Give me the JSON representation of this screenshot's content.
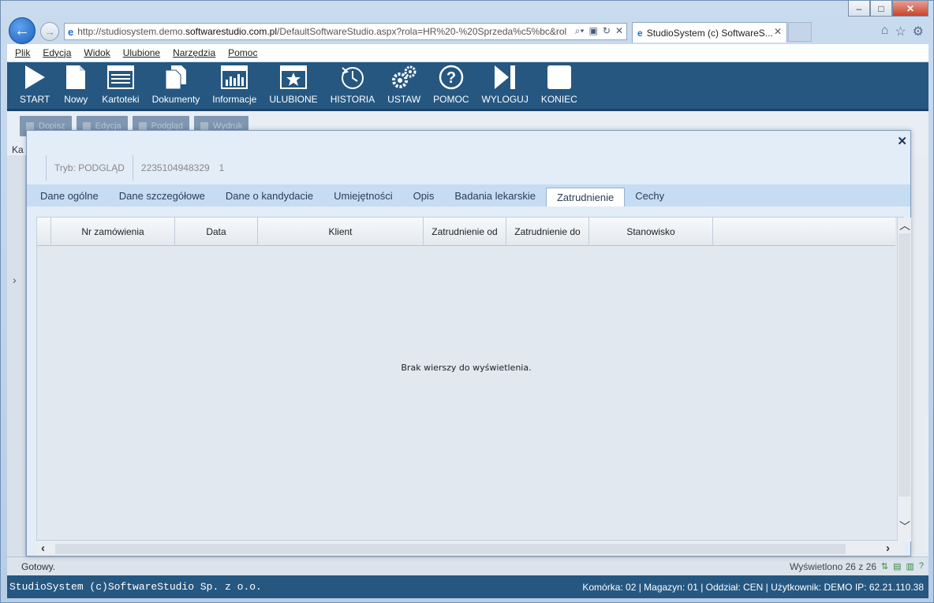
{
  "browser": {
    "address_prefix": "http://studiosystem.demo.",
    "address_domain": "softwarestudio.com.pl",
    "address_suffix": "/DefaultSoftwareStudio.aspx?rola=HR%20-%20Sprzeda%c5%bc&rol",
    "tab_title": "StudioSystem (c) SoftwareS...",
    "menu": [
      "Plik",
      "Edycja",
      "Widok",
      "Ulubione",
      "Narzędzia",
      "Pomoc"
    ]
  },
  "toolbar": {
    "items": [
      "START",
      "Nowy",
      "Kartoteki",
      "Dokumenty",
      "Informacje",
      "ULUBIONE",
      "HISTORIA",
      "USTAW",
      "POMOC",
      "WYLOGUJ",
      "KONIEC"
    ]
  },
  "sub_toolbar": [
    "Dopisz",
    "Edycja",
    "Podgląd",
    "Wydruk"
  ],
  "background": {
    "label": "Ka",
    "status_left": "Gotowy.",
    "status_right": "Wyświetlono 26 z 26"
  },
  "footer": {
    "left": "StudioSystem (c)SoftwareStudio Sp. z o.o.",
    "right": "Komórka: 02 | Magazyn: 01 | Oddział: CEN | Użytkownik: DEMO IP: 62.21.110.38"
  },
  "modal": {
    "mode": "Tryb: PODGLĄD",
    "record_id": "2235104948329",
    "record_num": "1",
    "tabs": [
      "Dane ogólne",
      "Dane szczegółowe",
      "Dane o kandydacie",
      "Umiejętności",
      "Opis",
      "Badania lekarskie",
      "Zatrudnienie",
      "Cechy"
    ],
    "active_tab": "Zatrudnienie",
    "columns": [
      "Nr zamówienia",
      "Data",
      "Klient",
      "Zatrudnienie od",
      "Zatrudnienie do",
      "Stanowisko"
    ],
    "empty_message": "Brak wierszy do wyświetlenia."
  }
}
